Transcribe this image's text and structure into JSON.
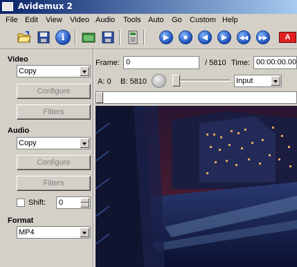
{
  "window": {
    "title": "Avidemux 2"
  },
  "menu": [
    "File",
    "Edit",
    "View",
    "Video",
    "Audio",
    "Tools",
    "Auto",
    "Go",
    "Custom",
    "Help"
  ],
  "toolbar": {
    "icons": [
      "open-file-icon",
      "save-icon",
      "info-icon",
      "open-folder-icon",
      "save-video-icon",
      "calculator-icon",
      "play-icon",
      "stop-icon",
      "previous-frame-icon",
      "next-frame-icon",
      "previous-keyframe-icon",
      "next-keyframe-icon",
      "red-a-icon"
    ],
    "marker_a_label": "A"
  },
  "video": {
    "heading": "Video",
    "codec": "Copy",
    "configure_label": "Configure",
    "filters_label": "Filters"
  },
  "audio": {
    "heading": "Audio",
    "codec": "Copy",
    "configure_label": "Configure",
    "filters_label": "Filters",
    "shift_label": "Shift:",
    "shift_value": "0"
  },
  "format": {
    "heading": "Format",
    "value": "MP4"
  },
  "navigation": {
    "frame_label": "Frame:",
    "frame_value": "0",
    "total_frames": "/ 5810",
    "time_label": "Time:",
    "time_value": "00:00:00.00",
    "a_label": "A: 0",
    "b_label": "B: 5810",
    "view_mode": "Input"
  },
  "colors": {
    "titlebar_start": "#0a246a",
    "titlebar_end": "#a6caf0",
    "toolbar_circle": "#1e4fb8",
    "window_bg": "#d4d0c8"
  }
}
